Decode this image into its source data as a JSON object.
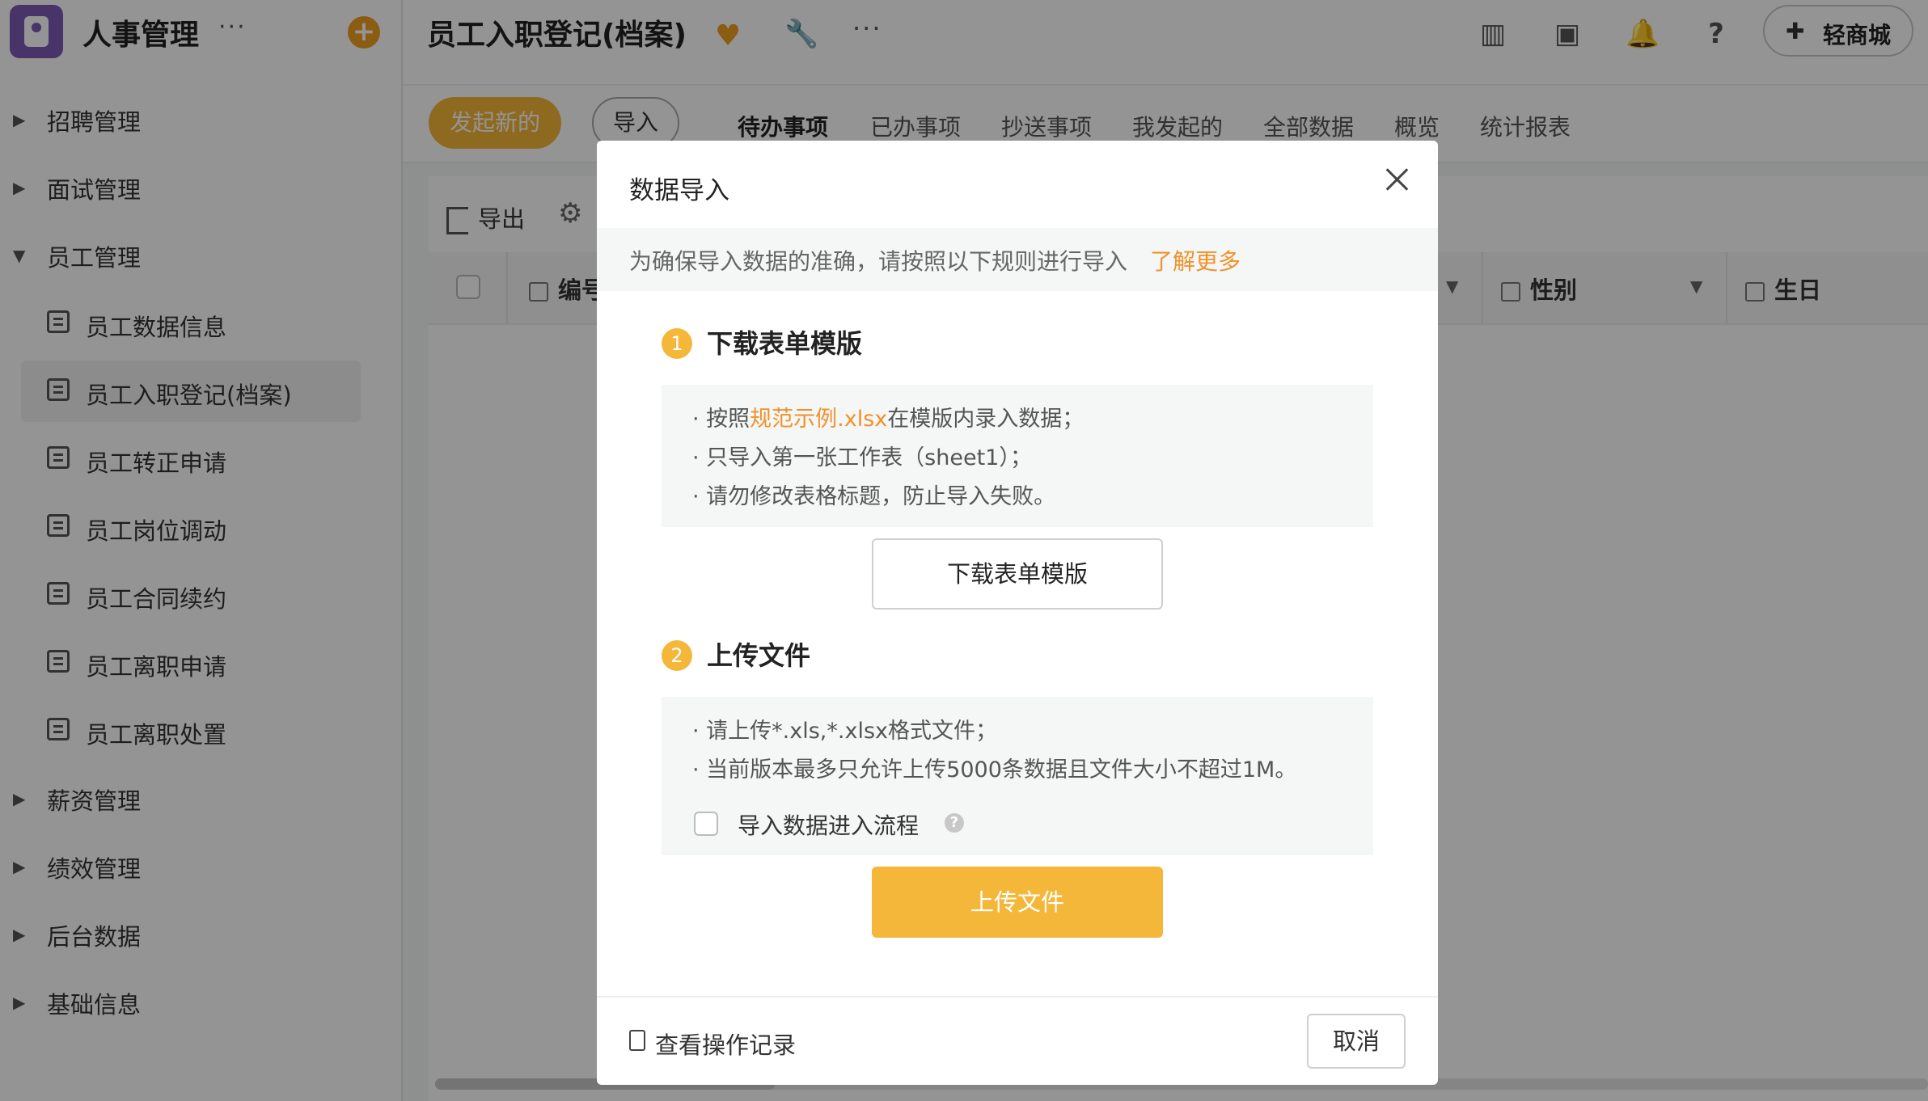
{
  "app": {
    "title": "人事管理",
    "more": "···",
    "add": "+"
  },
  "sidebar": {
    "menus": [
      {
        "label": "招聘管理",
        "expanded": false
      },
      {
        "label": "面试管理",
        "expanded": false
      },
      {
        "label": "员工管理",
        "expanded": true
      },
      {
        "label": "薪资管理",
        "expanded": false
      },
      {
        "label": "绩效管理",
        "expanded": false
      },
      {
        "label": "后台数据",
        "expanded": false
      },
      {
        "label": "基础信息",
        "expanded": false
      }
    ],
    "submenu": [
      {
        "label": "员工数据信息"
      },
      {
        "label": "员工入职登记(档案)",
        "active": true
      },
      {
        "label": "员工转正申请"
      },
      {
        "label": "员工岗位调动"
      },
      {
        "label": "员工合同续约"
      },
      {
        "label": "员工离职申请"
      },
      {
        "label": "员工离职处置"
      }
    ]
  },
  "topbar": {
    "title": "员工入职登记(档案)",
    "more": "···",
    "mall": "轻商城"
  },
  "toolbar": {
    "new_label": "发起新的",
    "import_label": "导入",
    "tabs": [
      "待办事项",
      "已办事项",
      "抄送事项",
      "我发起的",
      "全部数据",
      "概览",
      "统计报表"
    ]
  },
  "table": {
    "export_label": "导出",
    "columns": [
      "编号",
      "性别",
      "生日"
    ]
  },
  "modal": {
    "title": "数据导入",
    "notice": "为确保导入数据的准确，请按照以下规则进行导入",
    "learn_more": "了解更多",
    "step1": {
      "num": "1",
      "title": "下载表单模版",
      "tip1_pre": "按照",
      "tip1_link": "规范示例.xlsx",
      "tip1_post": "在模版内录入数据；",
      "tip2": "只导入第一张工作表（sheet1）；",
      "tip3": "请勿修改表格标题，防止导入失败。",
      "button": "下载表单模版"
    },
    "step2": {
      "num": "2",
      "title": "上传文件",
      "tip1": "请上传*.xls,*.xlsx格式文件；",
      "tip2": "当前版本最多只允许上传5000条数据且文件大小不超过1M。",
      "checkbox_label": "导入数据进入流程",
      "help": "?",
      "button": "上传文件"
    },
    "footer": {
      "records": "查看操作记录",
      "cancel": "取消"
    }
  },
  "colors": {
    "accent": "#f4b73a",
    "link": "#f0922b",
    "brand": "#7d5ab5"
  }
}
